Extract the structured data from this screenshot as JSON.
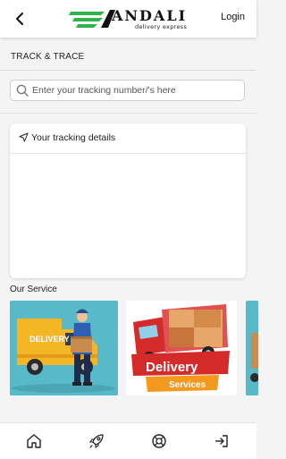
{
  "header": {
    "back_icon": "chevron-left-icon",
    "logo_text": "ANDALI",
    "logo_subtitle": "delivery express",
    "login_label": "Login"
  },
  "track": {
    "title": "TRACK & TRACE",
    "search_placeholder": "Enter your tracking number/'s here",
    "search_value": "",
    "details_label": "Your tracking details"
  },
  "services": {
    "title": "Our Service",
    "cards": [
      {
        "name": "delivery-man-van",
        "van_text": "DELIVERY"
      },
      {
        "name": "delivery-truck-services",
        "banner_text": "Delivery",
        "banner_sub": "Services"
      },
      {
        "name": "partial-service-card"
      }
    ]
  },
  "bottom_nav": {
    "items": [
      {
        "name": "home-icon"
      },
      {
        "name": "rocket-icon"
      },
      {
        "name": "lifebuoy-icon"
      },
      {
        "name": "logout-icon"
      }
    ]
  },
  "colors": {
    "accent_green": "#2fb34a",
    "card_teal": "#58b9c8",
    "banner_red": "#d42a2a",
    "banner_orange": "#f39a1e"
  }
}
